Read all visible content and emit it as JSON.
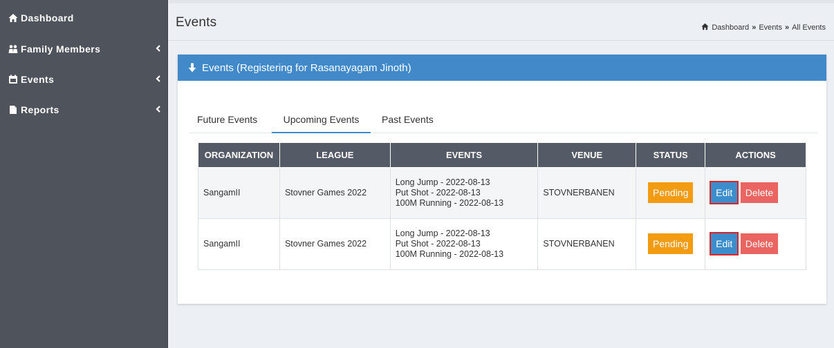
{
  "sidebar": {
    "items": [
      {
        "label": "Dashboard",
        "icon": "home-icon",
        "has_chevron": false
      },
      {
        "label": "Family Members",
        "icon": "users-icon",
        "has_chevron": true
      },
      {
        "label": "Events",
        "icon": "calendar-icon",
        "has_chevron": true
      },
      {
        "label": "Reports",
        "icon": "file-icon",
        "has_chevron": true
      }
    ]
  },
  "header": {
    "title": "Events",
    "breadcrumb": [
      "Dashboard",
      "Events",
      "All Events"
    ],
    "breadcrumb_separator": "»"
  },
  "box": {
    "title": "Events (Registering for Rasanayagam Jinoth)",
    "icon": "hand-down-icon"
  },
  "tabs": [
    {
      "label": "Future Events",
      "active": false
    },
    {
      "label": "Upcoming Events",
      "active": true
    },
    {
      "label": "Past Events",
      "active": false
    }
  ],
  "table": {
    "columns": [
      "ORGANIZATION",
      "LEAGUE",
      "EVENTS",
      "VENUE",
      "STATUS",
      "ACTIONS"
    ],
    "rows": [
      {
        "organization": "SangamII",
        "league": "Stovner Games 2022",
        "events": [
          "Long Jump - 2022-08-13",
          "Put Shot - 2022-08-13",
          "100M Running - 2022-08-13"
        ],
        "venue": "STOVNERBANEN",
        "status": "Pending",
        "edit_label": "Edit",
        "delete_label": "Delete"
      },
      {
        "organization": "SangamII",
        "league": "Stovner Games 2022",
        "events": [
          "Long Jump - 2022-08-13",
          "Put Shot - 2022-08-13",
          "100M Running - 2022-08-13"
        ],
        "venue": "STOVNERBANEN",
        "status": "Pending",
        "edit_label": "Edit",
        "delete_label": "Delete"
      }
    ]
  },
  "colors": {
    "sidebar_bg": "#4f535b",
    "box_header": "#4289ca",
    "table_header": "#545a66",
    "pending": "#f39c12",
    "edit": "#3c8dcc",
    "delete": "#ea6462",
    "highlight_outline": "#e12222"
  }
}
